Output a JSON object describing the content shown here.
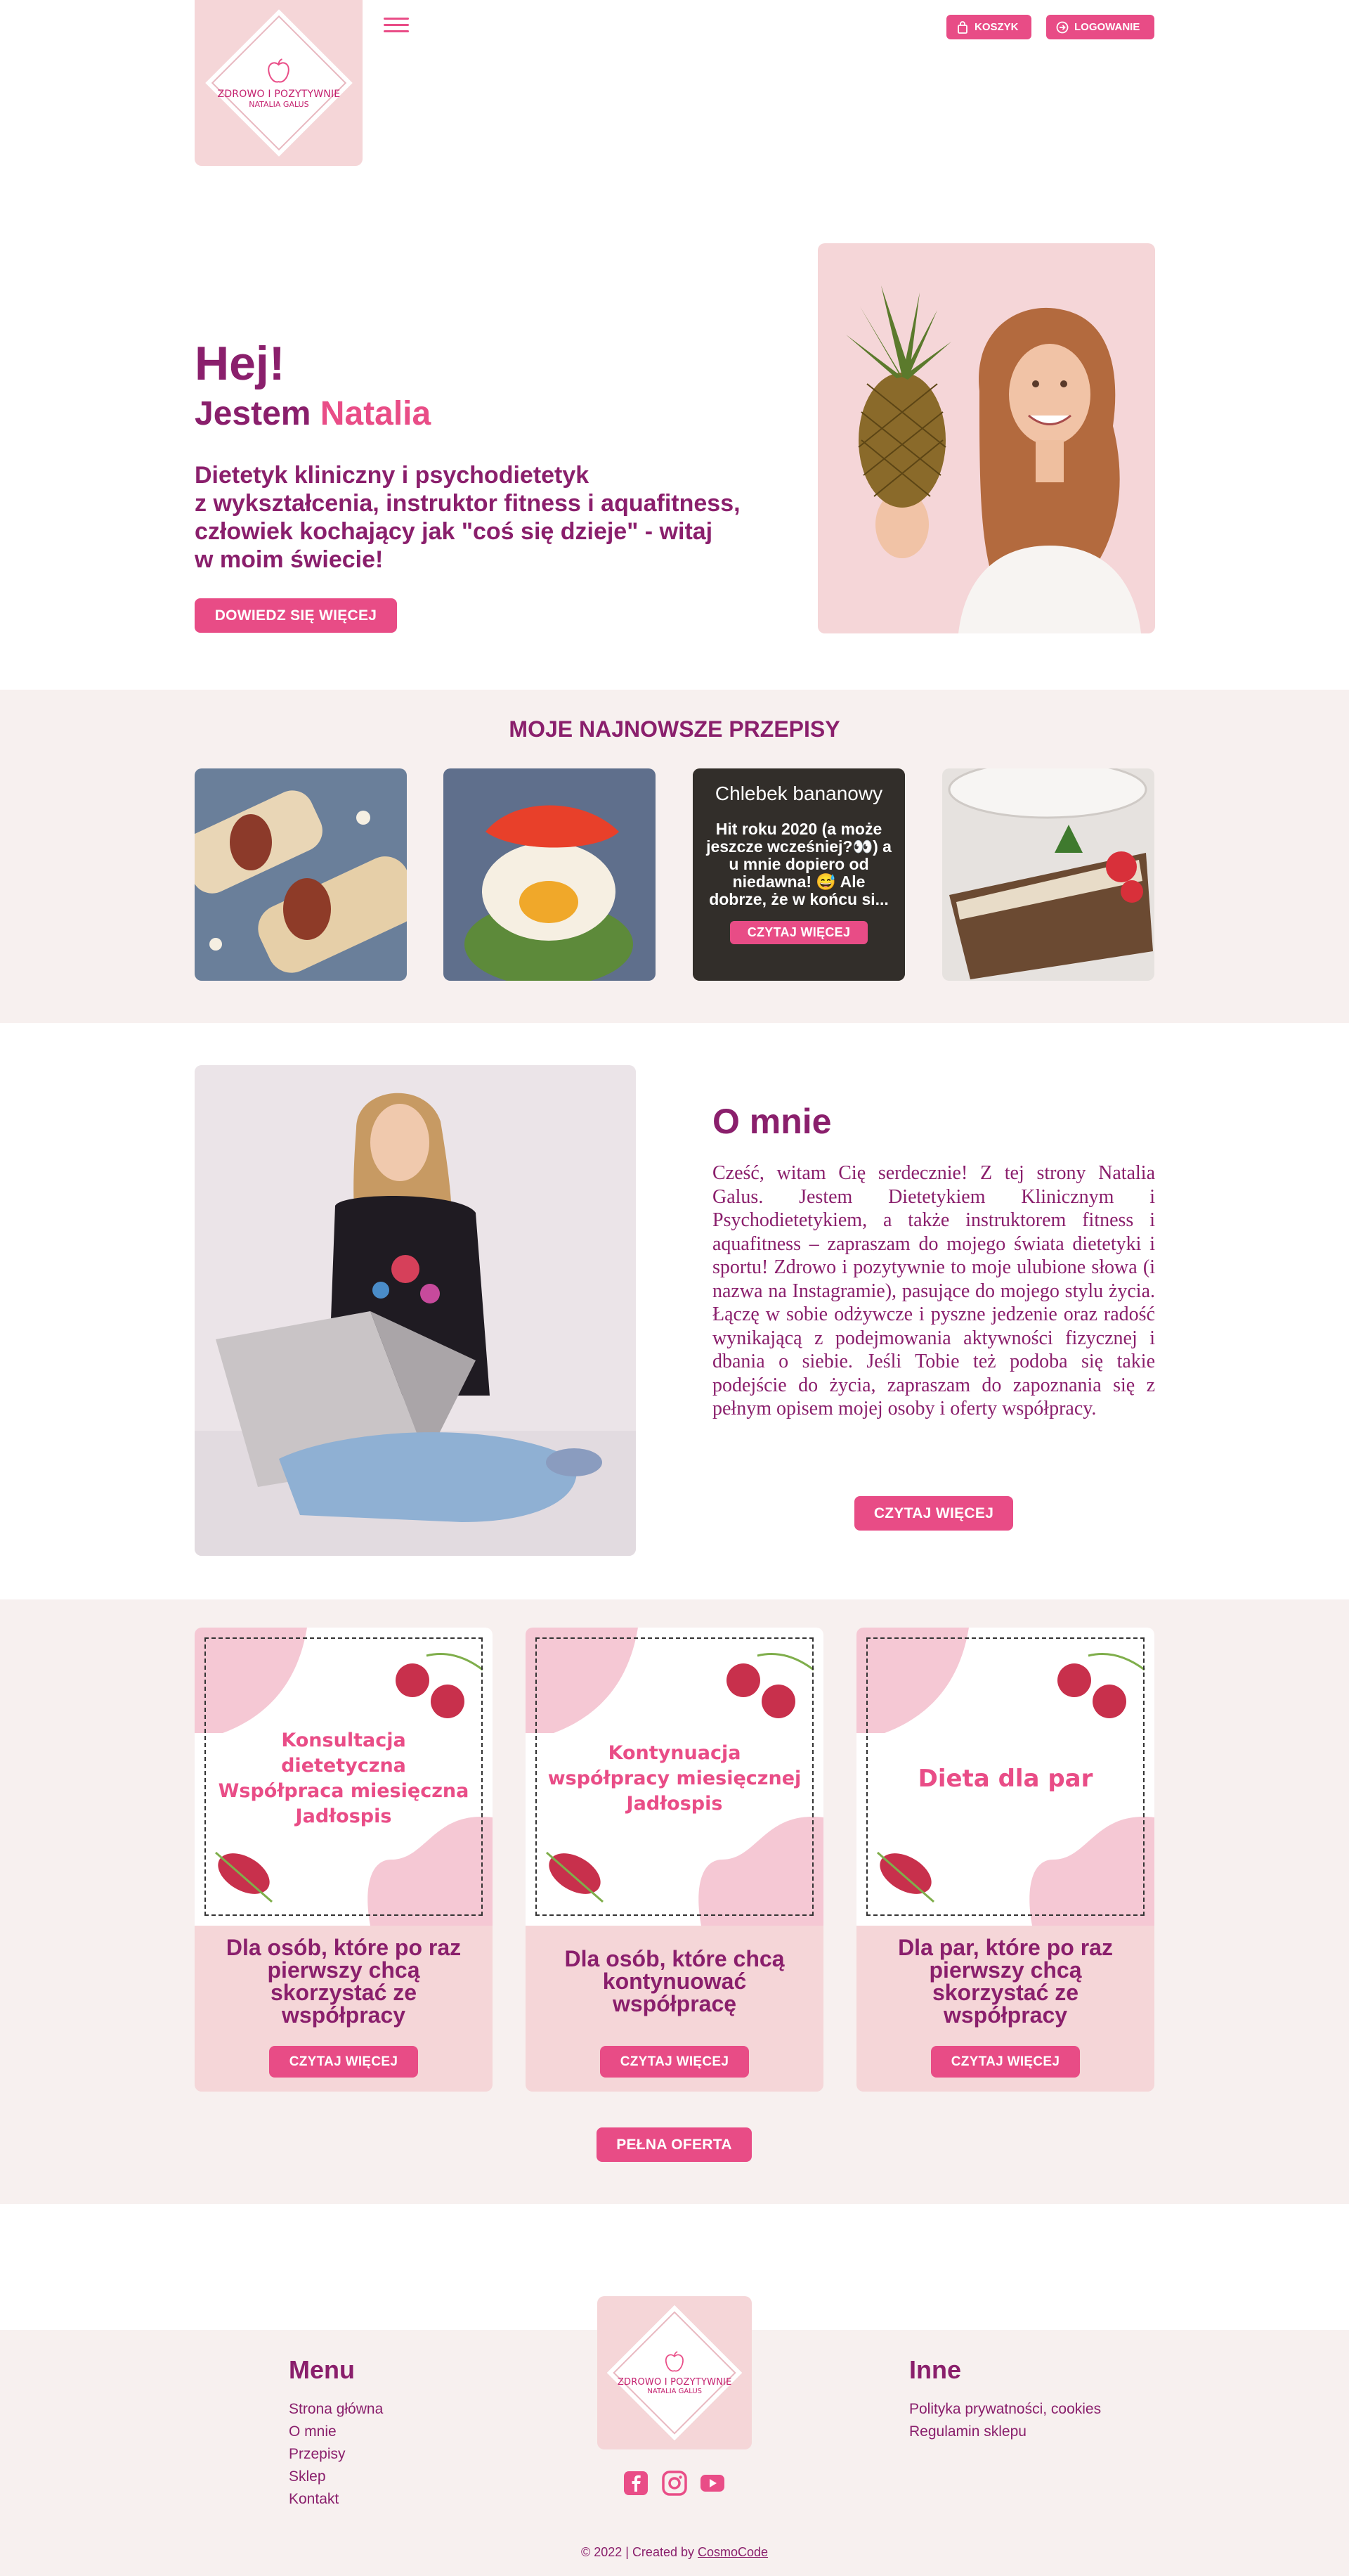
{
  "header": {
    "logo_line1": "ZDROWO I POZYTYWNIE",
    "logo_line2": "NATALIA GALUS",
    "cart_label": "KOSZYK",
    "login_label": "LOGOWANIE"
  },
  "hero": {
    "greeting": "Hej!",
    "name_prefix": "Jestem",
    "name": "Natalia",
    "description": [
      "Dietetyk kliniczny i psychodietetyk",
      "z wykształcenia, instruktor fitness i aquafitness,",
      "człowiek kochający jak \"coś się dzieje\" - witaj",
      "w moim świecie!"
    ],
    "button": "DOWIEDZ SIĘ WIĘCEJ"
  },
  "recipes": {
    "title": "MOJE NAJNOWSZE PRZEPISY",
    "featured": {
      "title": "Chlebek bananowy",
      "text": "Hit roku 2020 (a może jeszcze wcześniej?👀) a u mnie dopiero od niedawna! 😅 Ale dobrze, że w końcu si...",
      "button": "CZYTAJ WIĘCEJ"
    }
  },
  "about": {
    "title": "O mnie",
    "text": "Cześć, witam Cię serdecznie! Z tej strony Natalia Galus. Jestem Dietetykiem Klinicznym i Psychodietetykiem, a także instruktorem fitness i aquafitness – zapraszam do mojego świata dietetyki i sportu! Zdrowo i pozytywnie to moje ulubione słowa (i nazwa na Instagramie), pasujące do mojego stylu życia. Łączę w sobie odżywcze i pyszne jedzenie oraz radość wynikającą z podejmowania aktywności fizycznej i dbania o siebie. Jeśli Tobie też podoba się takie podejście do życia, zapraszam do zapoznania się z pełnym opisem mojej osoby i oferty współpracy.",
    "button": "CZYTAJ WIĘCEJ"
  },
  "offers": {
    "items": [
      {
        "art_title": "Konsultacja dietetyczna\nWspółpraca miesięczna\nJadłospis",
        "description": "Dla osób, które po raz pierwszy chcą skorzystać ze współpracy",
        "button": "CZYTAJ WIĘCEJ"
      },
      {
        "art_title": "Kontynuacja współpracy miesięcznej\nJadłospis",
        "description": "Dla osób, które chcą kontynuować współpracę",
        "button": "CZYTAJ WIĘCEJ"
      },
      {
        "art_title": "Dieta dla par",
        "description": "Dla par, które po raz pierwszy chcą skorzystać ze współpracy",
        "button": "CZYTAJ WIĘCEJ"
      }
    ],
    "full_button": "PEŁNA OFERTA"
  },
  "footer": {
    "menu_title": "Menu",
    "menu_links": [
      "Strona główna",
      "O mnie",
      "Przepisy",
      "Sklep",
      "Kontakt"
    ],
    "other_title": "Inne",
    "other_links": [
      "Polityka prywatności, cookies",
      "Regulamin sklepu"
    ],
    "social": [
      "facebook-icon",
      "instagram-icon",
      "youtube-icon"
    ],
    "copyright_prefix": "© 2022 | Created by ",
    "copyright_link": "CosmoCode"
  },
  "colors": {
    "primary": "#8a1f6c",
    "accent": "#e94d87",
    "soft_pink": "#f5d6d8",
    "bg_light": "#f7f0ef"
  }
}
